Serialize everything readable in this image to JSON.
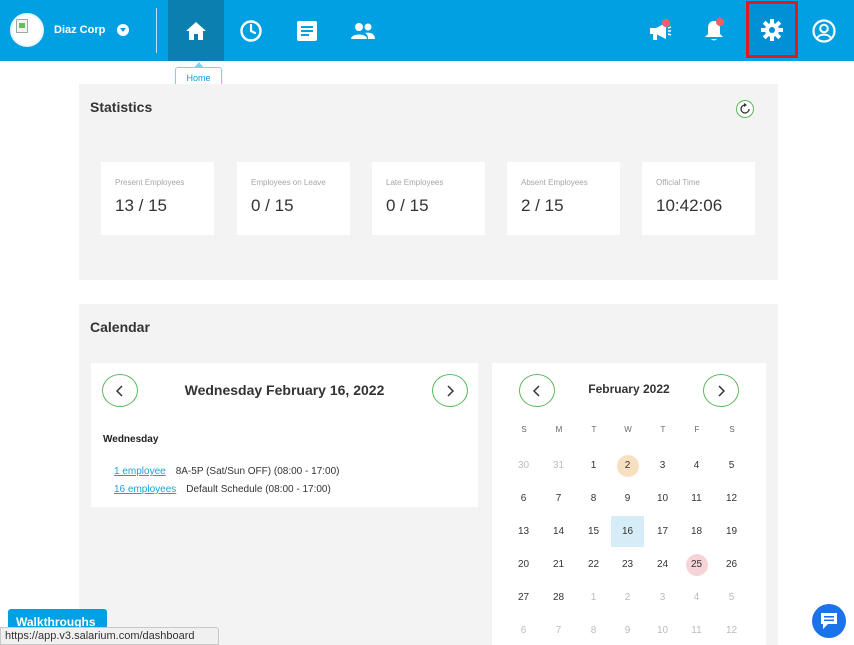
{
  "header": {
    "company_name": "Diaz Corp",
    "nav": [
      {
        "name": "home-icon",
        "active": true
      },
      {
        "name": "clock-icon"
      },
      {
        "name": "document-icon"
      },
      {
        "name": "people-icon"
      }
    ],
    "right_icons": [
      "megaphone-icon",
      "bell-icon",
      "gear-icon",
      "user-icon"
    ],
    "tooltip": "Home",
    "colors": {
      "bar": "#00a0e3",
      "active": "#0a7fb0",
      "highlight_border": "#e21a1a",
      "notification": "#f26065"
    }
  },
  "statistics": {
    "title": "Statistics",
    "cards": [
      {
        "label": "Present Employees",
        "value": "13 / 15"
      },
      {
        "label": "Employees on Leave",
        "value": "0 / 15"
      },
      {
        "label": "Late Employees",
        "value": "0 / 15"
      },
      {
        "label": "Absent Employees",
        "value": "2 / 15"
      },
      {
        "label": "Official Time",
        "value": "10:42:06"
      }
    ]
  },
  "calendar": {
    "title": "Calendar",
    "day_view": {
      "date_title": "Wednesday February 16, 2022",
      "weekday": "Wednesday",
      "schedules": [
        {
          "link": "1 employee",
          "text": "8A-5P (Sat/Sun OFF) (08:00 - 17:00)"
        },
        {
          "link": "16 employees",
          "text": "Default Schedule (08:00 - 17:00)"
        }
      ]
    },
    "month_view": {
      "title": "February 2022",
      "weekdays": [
        "S",
        "M",
        "T",
        "W",
        "T",
        "F",
        "S"
      ],
      "weeks": [
        [
          [
            "30",
            "muted"
          ],
          [
            "31",
            "muted"
          ],
          [
            "1",
            ""
          ],
          [
            "2",
            "orange"
          ],
          [
            "3",
            ""
          ],
          [
            "4",
            ""
          ],
          [
            "5",
            ""
          ]
        ],
        [
          [
            "6",
            ""
          ],
          [
            "7",
            ""
          ],
          [
            "8",
            ""
          ],
          [
            "9",
            ""
          ],
          [
            "10",
            ""
          ],
          [
            "11",
            ""
          ],
          [
            "12",
            ""
          ]
        ],
        [
          [
            "13",
            ""
          ],
          [
            "14",
            ""
          ],
          [
            "15",
            ""
          ],
          [
            "16",
            "selected"
          ],
          [
            "17",
            ""
          ],
          [
            "18",
            ""
          ],
          [
            "19",
            ""
          ]
        ],
        [
          [
            "20",
            ""
          ],
          [
            "21",
            ""
          ],
          [
            "22",
            ""
          ],
          [
            "23",
            ""
          ],
          [
            "24",
            ""
          ],
          [
            "25",
            "red"
          ],
          [
            "26",
            ""
          ]
        ],
        [
          [
            "27",
            ""
          ],
          [
            "28",
            ""
          ],
          [
            "1",
            "muted"
          ],
          [
            "2",
            "muted"
          ],
          [
            "3",
            "muted"
          ],
          [
            "4",
            "muted"
          ],
          [
            "5",
            "muted"
          ]
        ],
        [
          [
            "6",
            "muted"
          ],
          [
            "7",
            "muted"
          ],
          [
            "8",
            "muted"
          ],
          [
            "9",
            "muted"
          ],
          [
            "10",
            "muted"
          ],
          [
            "11",
            "muted"
          ],
          [
            "12",
            "muted"
          ]
        ]
      ],
      "colors": {
        "selected": "#d6ecf7",
        "orange": "#f7e0c0",
        "red": "#f6d3d6"
      }
    }
  },
  "footer": {
    "walkthroughs": "Walkthroughs",
    "status_url": "https://app.v3.salarium.com/dashboard"
  }
}
